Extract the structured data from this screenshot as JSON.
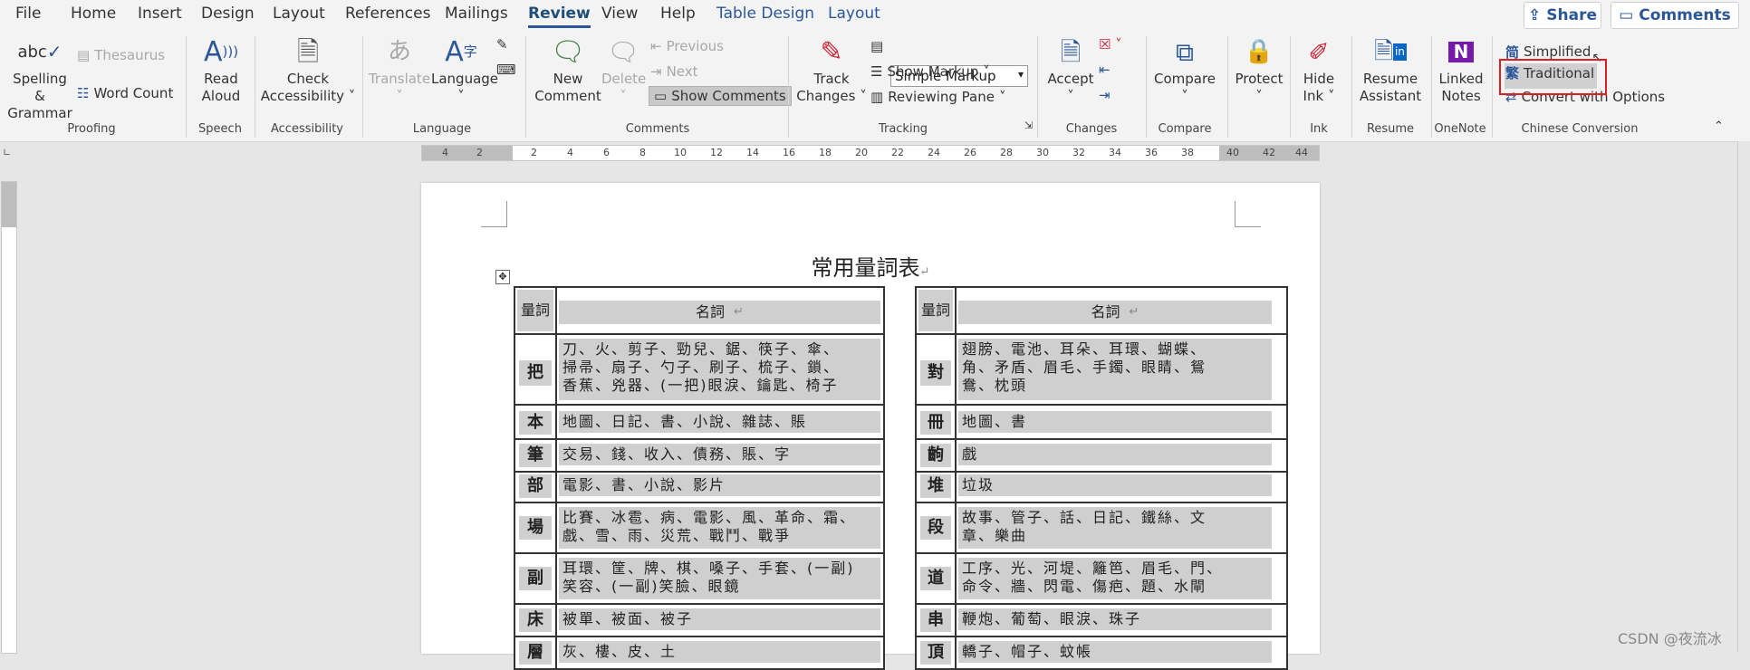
{
  "menu": {
    "tabs": [
      "File",
      "Home",
      "Insert",
      "Design",
      "Layout",
      "References",
      "Mailings",
      "Review",
      "View",
      "Help",
      "Table Design",
      "Layout"
    ],
    "active": "Review",
    "share_label": "Share",
    "comments_label": "Comments"
  },
  "ribbon": {
    "proofing": {
      "spelling": "Spelling &",
      "grammar": "Grammar",
      "abc": "abc",
      "thesaurus": "Thesaurus",
      "word_count": "Word Count",
      "label": "Proofing"
    },
    "speech": {
      "read": "Read",
      "aloud": "Aloud",
      "label": "Speech"
    },
    "accessibility": {
      "check": "Check",
      "access": "Accessibility",
      "label": "Accessibility"
    },
    "language": {
      "translate": "Translate",
      "language": "Language",
      "label": "Language"
    },
    "comments": {
      "new": "New",
      "comment": "Comment",
      "delete": "Delete",
      "previous": "Previous",
      "next": "Next",
      "show_comments": "Show Comments",
      "label": "Comments"
    },
    "tracking": {
      "track": "Track",
      "changes": "Changes",
      "markup_value": "Simple Markup",
      "show_markup": "Show Markup",
      "reviewing_pane": "Reviewing Pane",
      "label": "Tracking"
    },
    "changes": {
      "accept": "Accept",
      "label": "Changes"
    },
    "compare": {
      "compare": "Compare",
      "label": "Compare"
    },
    "protect": {
      "protect": "Protect"
    },
    "ink": {
      "hide": "Hide",
      "ink": "Ink",
      "label": "Ink"
    },
    "resume": {
      "resume": "Resume",
      "assistant": "Assistant",
      "label": "Resume"
    },
    "onenote": {
      "linked": "Linked",
      "notes": "Notes",
      "label": "OneNote"
    },
    "chinese": {
      "simplified": "Simplified",
      "traditional": "Traditional",
      "convert": "Convert with Options",
      "label": "Chinese Conversion",
      "simp_glyph": "简",
      "trad_glyph": "繁"
    }
  },
  "ruler": {
    "numbers": [
      "4",
      "2",
      "2",
      "4",
      "6",
      "8",
      "10",
      "12",
      "14",
      "16",
      "18",
      "20",
      "22",
      "24",
      "26",
      "28",
      "30",
      "32",
      "34",
      "36",
      "38",
      "40",
      "42",
      "44"
    ]
  },
  "document": {
    "title": "常用量詞表",
    "header_measure": "量詞",
    "header_noun": "名詞",
    "left_rows": [
      {
        "q": "把",
        "nouns": [
          "刀、火、剪子、勁兒、鋸、筷子、傘、",
          "掃帚、扇子、勺子、刷子、梳子、鎖、",
          "香蕉、兇器、(一把)眼淚、鑰匙、椅子"
        ]
      },
      {
        "q": "本",
        "nouns": [
          "地圖、日記、書、小說、雜誌、賬"
        ]
      },
      {
        "q": "筆",
        "nouns": [
          "交易、錢、收入、債務、賬、字"
        ]
      },
      {
        "q": "部",
        "nouns": [
          "電影、書、小說、影片"
        ]
      },
      {
        "q": "場",
        "nouns": [
          "比賽、冰雹、病、電影、風、革命、霜、",
          "戲、雪、雨、災荒、戰鬥、戰爭"
        ]
      },
      {
        "q": "副",
        "nouns": [
          "耳環、筐、牌、棋、嗓子、手套、(一副)",
          "笑容、(一副)笑臉、眼鏡"
        ]
      },
      {
        "q": "床",
        "nouns": [
          "被單、被面、被子"
        ]
      },
      {
        "q": "層",
        "nouns": [
          "灰、樓、皮、土"
        ]
      }
    ],
    "right_rows": [
      {
        "q": "對",
        "nouns": [
          "翅膀、電池、耳朵、耳環、蝴蝶、",
          "角、矛盾、眉毛、手鐲、眼睛、鴛",
          "鴦、枕頭"
        ]
      },
      {
        "q": "冊",
        "nouns": [
          "地圖、書"
        ]
      },
      {
        "q": "齣",
        "nouns": [
          "戲"
        ]
      },
      {
        "q": "堆",
        "nouns": [
          "垃圾"
        ]
      },
      {
        "q": "段",
        "nouns": [
          "故事、管子、話、日記、鐵絲、文",
          "章、樂曲"
        ]
      },
      {
        "q": "道",
        "nouns": [
          "工序、光、河堤、籬笆、眉毛、門、",
          "命令、牆、閃電、傷疤、題、水閘"
        ]
      },
      {
        "q": "串",
        "nouns": [
          "鞭炮、葡萄、眼淚、珠子"
        ]
      },
      {
        "q": "頂",
        "nouns": [
          "轎子、帽子、蚊帳"
        ]
      }
    ],
    "para_mark": "↵"
  },
  "watermark": "CSDN @夜流冰"
}
